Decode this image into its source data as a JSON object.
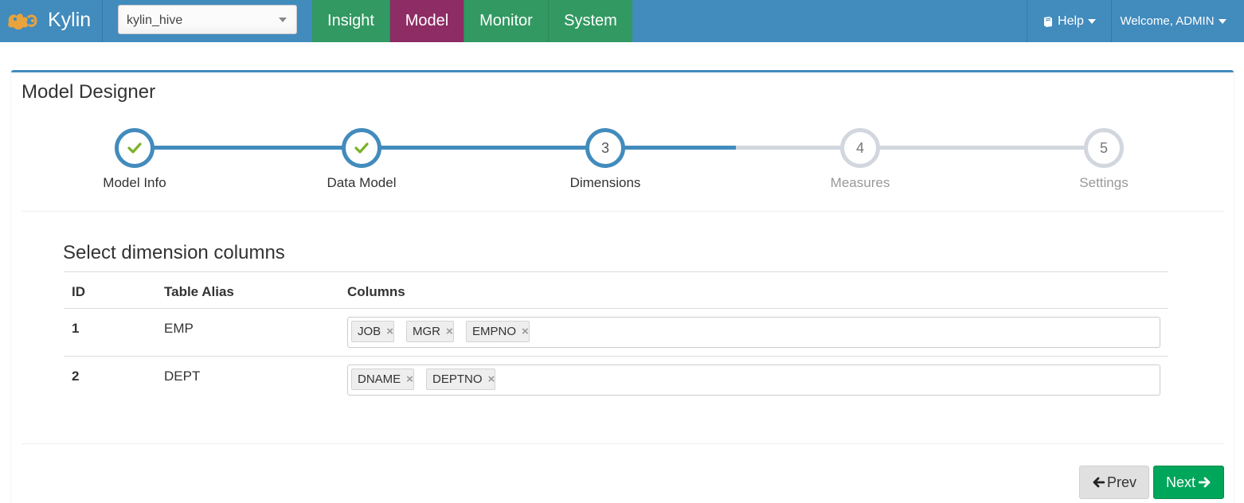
{
  "app": {
    "brand": "Kylin",
    "logo_icon": "kylin-logo-icon"
  },
  "project_select": {
    "value": "kylin_hive"
  },
  "nav": {
    "tabs": [
      {
        "label": "Insight"
      },
      {
        "label": "Model"
      },
      {
        "label": "Monitor"
      },
      {
        "label": "System"
      }
    ],
    "active_tab": "Model",
    "help_label": "Help",
    "help_icon": "book-icon",
    "welcome_label": "Welcome, ADMIN"
  },
  "page": {
    "title": "Model Designer"
  },
  "wizard": {
    "steps": [
      {
        "number": "1",
        "label": "Model Info",
        "state": "done"
      },
      {
        "number": "2",
        "label": "Data Model",
        "state": "done"
      },
      {
        "number": "3",
        "label": "Dimensions",
        "state": "current"
      },
      {
        "number": "4",
        "label": "Measures",
        "state": "todo"
      },
      {
        "number": "5",
        "label": "Settings",
        "state": "todo"
      }
    ]
  },
  "dimensions": {
    "title": "Select dimension columns",
    "headers": {
      "id": "ID",
      "alias": "Table Alias",
      "columns": "Columns"
    },
    "rows": [
      {
        "id": "1",
        "alias": "EMP",
        "columns": [
          "JOB",
          "MGR",
          "EMPNO"
        ]
      },
      {
        "id": "2",
        "alias": "DEPT",
        "columns": [
          "DNAME",
          "DEPTNO"
        ]
      }
    ],
    "remove_glyph": "×"
  },
  "buttons": {
    "prev_label": "Prev",
    "next_label": "Next"
  },
  "colors": {
    "navbar": "#428bbd",
    "nav_green": "#329962",
    "nav_active": "#8e2c65",
    "step_done": "#428bbd",
    "step_todo": "#d2d6de",
    "check": "#7cb228",
    "next_button": "#00a65a"
  }
}
